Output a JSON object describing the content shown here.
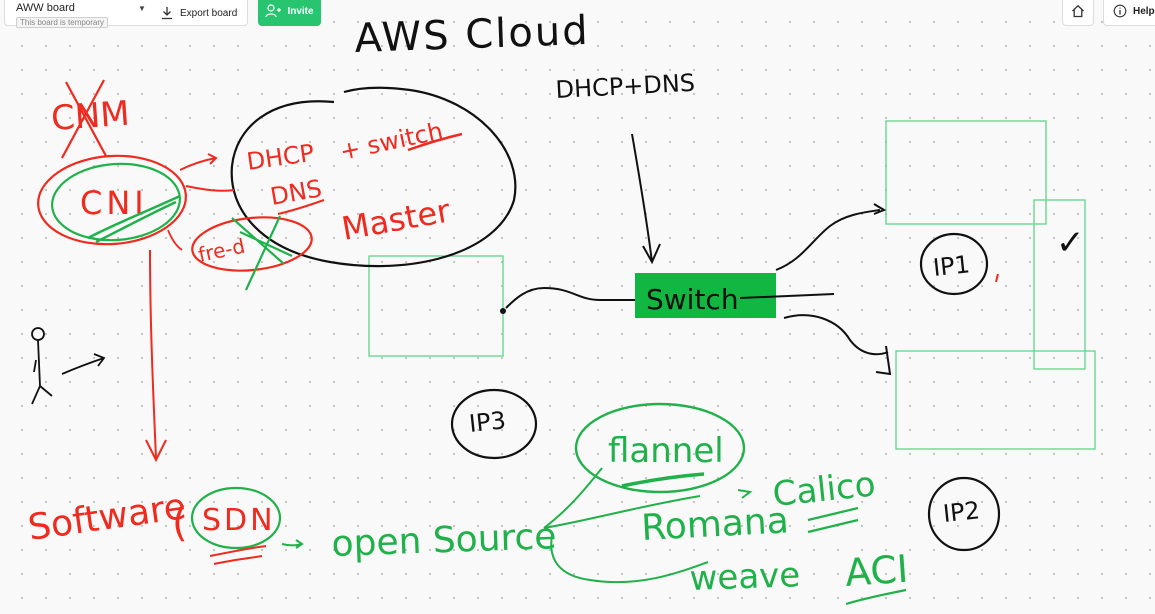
{
  "toolbar": {
    "board_name": "AWW board",
    "board_subtitle": "This board is temporary",
    "export_label": "Export board",
    "invite_label": "Invite",
    "help_label": "Help"
  },
  "icons": {
    "dropdown": "chevron-down-icon",
    "export": "download-icon",
    "invite": "add-user-icon",
    "home": "home-icon",
    "help": "info-icon"
  },
  "colors": {
    "red_ink": "#ef2a1f",
    "green_ink": "#21b14b",
    "black_ink": "#111111",
    "switch_fill": "#12b742",
    "invite_bg": "#29c46f"
  },
  "board": {
    "aws_cloud": "AWS Cloud",
    "dhcp_dns_top": "DHCP+DNS",
    "cnm": "CNM",
    "cni": "CNI",
    "dhcp_master": "DHCP",
    "dns_master": "DNS",
    "plus_switch": "+ switch",
    "master": "Master",
    "crossed_word": "fre-d",
    "switch": "Switch",
    "ip1": "IP1",
    "ip2": "IP2",
    "ip3": "IP3",
    "checkmark": "✓",
    "software": "Software",
    "sdn": "SDN",
    "open_source": "open Source",
    "flannel": "flannel",
    "romana": "Romana",
    "calico": "Calico",
    "weave": "weave",
    "aci": "ACI"
  }
}
